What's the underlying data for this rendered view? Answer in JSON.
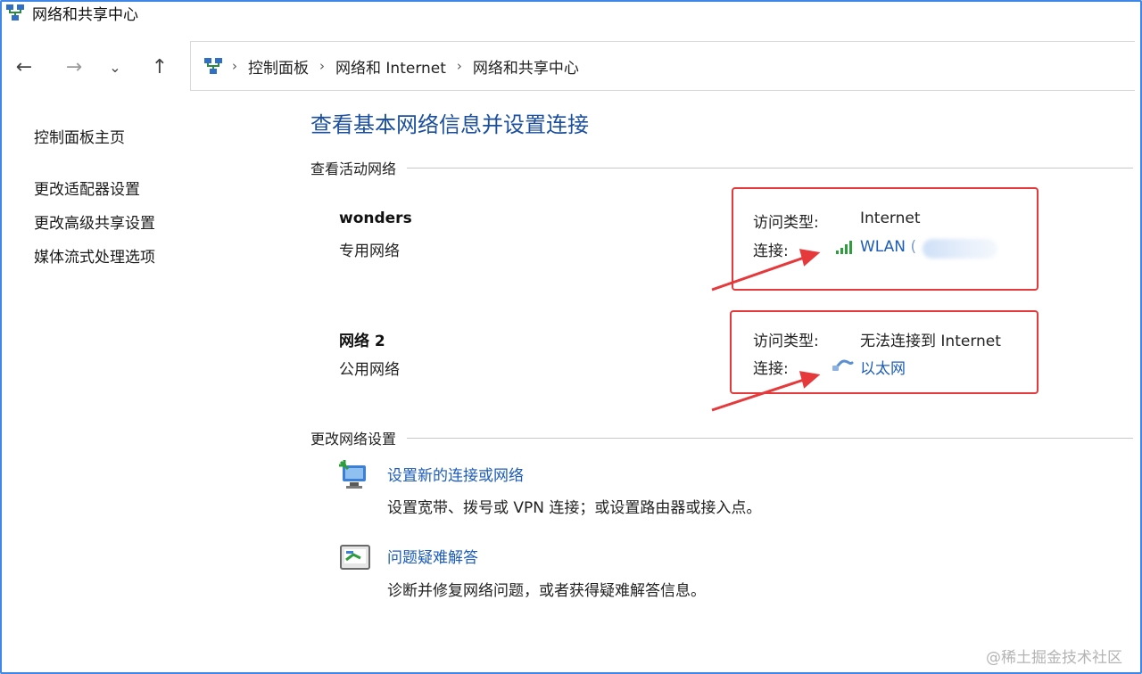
{
  "window": {
    "title": "网络和共享中心"
  },
  "nav": {
    "back": "←",
    "forward": "→",
    "recent": "⌄",
    "up": "↑"
  },
  "breadcrumb": {
    "items": [
      "控制面板",
      "网络和 Internet",
      "网络和共享中心"
    ],
    "separator": "›"
  },
  "sidebar": {
    "items": [
      "控制面板主页",
      "更改适配器设置",
      "更改高级共享设置",
      "媒体流式处理选项"
    ]
  },
  "main": {
    "title": "查看基本网络信息并设置连接",
    "active_section": "查看活动网络",
    "networks": [
      {
        "name": "wonders",
        "type": "专用网络",
        "access_label": "访问类型:",
        "access_value": "Internet",
        "conn_label": "连接:",
        "conn_value": "WLAN",
        "conn_suffix": "("
      },
      {
        "name": "网络 2",
        "type": "公用网络",
        "access_label": "访问类型:",
        "access_value": "无法连接到 Internet",
        "conn_label": "连接:",
        "conn_value": "以太网"
      }
    ],
    "change_section": "更改网络设置",
    "tasks": [
      {
        "title": "设置新的连接或网络",
        "desc": "设置宽带、拨号或 VPN 连接；或设置路由器或接入点。"
      },
      {
        "title": "问题疑难解答",
        "desc": "诊断并修复网络问题，或者获得疑难解答信息。"
      }
    ]
  },
  "watermark": "@稀土掘金技术社区",
  "colors": {
    "link": "#1d5cb8",
    "title": "#1b4f9e",
    "highlight": "#e5393b",
    "frame": "#3f86e6"
  }
}
